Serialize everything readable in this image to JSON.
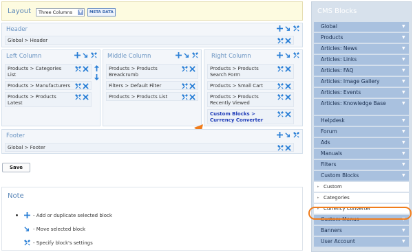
{
  "layout": {
    "title": "Layout",
    "select_value": "Three Columns",
    "meta_button": "META DATA"
  },
  "panels": {
    "header": {
      "title": "Header",
      "blocks": [
        "Global > Header"
      ]
    },
    "left": {
      "title": "Left Column",
      "blocks": [
        "Products > Categories List",
        "Products > Manufacturers",
        "Products > Products Latest"
      ]
    },
    "middle": {
      "title": "Middle Column",
      "blocks": [
        "Products > Products Breadcrumb",
        "Filters > Default Filter",
        "Products > Products List"
      ]
    },
    "right": {
      "title": "Right Column",
      "blocks": [
        "Products > Products Search Form",
        "Products > Small Cart",
        "Products > Products Recently Viewed",
        "Custom Blocks > Currency Converter"
      ]
    },
    "footer": {
      "title": "Footer",
      "blocks": [
        "Global > Footer"
      ]
    }
  },
  "save_label": "Save",
  "note": {
    "title": "Note",
    "items": [
      "- Add or duplicate selected block",
      "- Move selected block",
      "- Specify block's settings"
    ]
  },
  "cms": {
    "title": "CMS Blocks",
    "items": [
      "Global",
      "Products",
      "Articles: News",
      "Articles: Links",
      "Articles: FAQ",
      "Articles: Image Gallery",
      "Articles: Events",
      "Articles: Knowledge Base",
      "Helpdesk",
      "Forum",
      "Ads",
      "Manuals",
      "Filters",
      "Custom Blocks"
    ],
    "sub_items": [
      "Custom",
      "Categories",
      "Currency Converter"
    ],
    "items_after": [
      "Custom Menus",
      "Banners",
      "User Account"
    ]
  },
  "colors": {
    "accent_orange": "#f07c1b",
    "cms_item_bg": "#a9c1df",
    "panel_title": "#6a94c2"
  }
}
